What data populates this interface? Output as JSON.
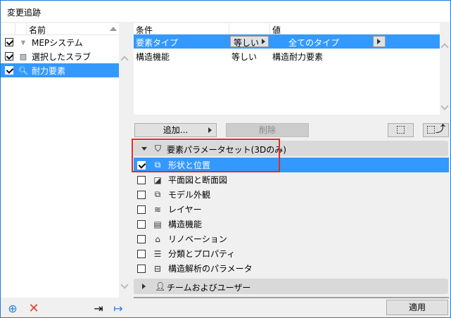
{
  "window": {
    "title": "変更追跡"
  },
  "left_list": {
    "header": "名前",
    "items": [
      {
        "label": "MEPシステム",
        "checked": true,
        "icon": "mep-icon",
        "selected": false
      },
      {
        "label": "選択したスラブ",
        "checked": true,
        "icon": "slab-icon",
        "selected": false
      },
      {
        "label": "耐力要素",
        "checked": true,
        "icon": "structural-search-icon",
        "selected": true
      }
    ]
  },
  "criteria": {
    "headers": [
      "条件",
      "",
      "値"
    ],
    "rows": [
      {
        "condition": "要素タイプ",
        "operator": "等しい",
        "value": "全てのタイプ",
        "selected": true
      },
      {
        "condition": "構造機能",
        "operator": "等しい",
        "value": "構造耐力要素",
        "selected": false
      }
    ]
  },
  "buttons": {
    "add": "追加...",
    "delete": "削除",
    "apply": "適用"
  },
  "param_group": {
    "label": "要素パラメータセット(3Dのみ)",
    "expanded": true
  },
  "params": [
    {
      "label": "形状と位置",
      "checked": true,
      "selected": true,
      "icon": "shape-position-icon"
    },
    {
      "label": "平面図と断面図",
      "checked": false,
      "icon": "floorplan-section-icon"
    },
    {
      "label": "モデル外観",
      "checked": false,
      "icon": "model-appearance-icon"
    },
    {
      "label": "レイヤー",
      "checked": false,
      "icon": "layers-icon"
    },
    {
      "label": "構造機能",
      "checked": false,
      "icon": "structural-function-icon"
    },
    {
      "label": "リノベーション",
      "checked": false,
      "icon": "renovation-icon"
    },
    {
      "label": "分類とプロパティ",
      "checked": false,
      "icon": "classification-icon"
    },
    {
      "label": "構造解析のパラメータ",
      "checked": false,
      "icon": "structural-analysis-icon"
    }
  ],
  "team_group": {
    "label": "チームおよびユーザー",
    "expanded": false
  },
  "colors": {
    "accent": "#3399ff",
    "highlight": "#e52a2a",
    "delete": "#e8402a",
    "border": "#1c7ad6"
  }
}
